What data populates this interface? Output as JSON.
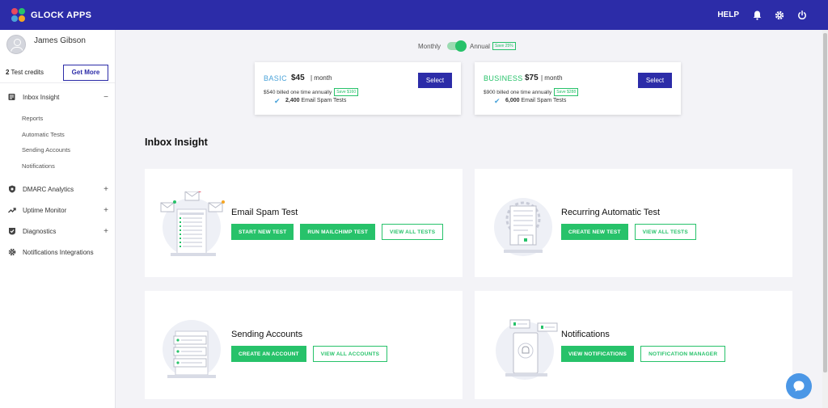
{
  "app": {
    "name": "GLOCK APPS"
  },
  "topbar": {
    "help": "HELP"
  },
  "user": {
    "name": "James Gibson",
    "credits_count": "2",
    "credits_label": "Test credits",
    "get_more": "Get More"
  },
  "sidebar": {
    "inbox": {
      "label": "Inbox Insight",
      "toggle": "−"
    },
    "subitems": [
      "Reports",
      "Automatic Tests",
      "Sending Accounts",
      "Notifications"
    ],
    "dmarc": {
      "label": "DMARC Analytics",
      "toggle": "+"
    },
    "uptime": {
      "label": "Uptime Monitor",
      "toggle": "+"
    },
    "diagnostics": {
      "label": "Diagnostics",
      "toggle": "+"
    },
    "notif_int": {
      "label": "Notifications Integrations"
    }
  },
  "billing": {
    "monthly": "Monthly",
    "annual": "Annual",
    "annual_save": "Save 25%"
  },
  "plans": [
    {
      "name": "BASIC",
      "price": "$45",
      "per": "| month",
      "billed": "$540 billed one time annually",
      "save": "Save $160",
      "tests_count": "2,400",
      "tests_label": "Email Spam Tests",
      "select": "Select",
      "color": "#4aa3d9"
    },
    {
      "name": "BUSINESS",
      "price": "$75",
      "per": "| month",
      "billed": "$900 billed one time annually",
      "save": "Save $288",
      "tests_count": "6,000",
      "tests_label": "Email Spam Tests",
      "select": "Select",
      "color": "#27c26a"
    }
  ],
  "section_title": "Inbox Insight",
  "cards": [
    {
      "title": "Email Spam Test",
      "buttons": [
        "START NEW TEST",
        "RUN MAILCHIMP TEST",
        "VIEW ALL TESTS"
      ]
    },
    {
      "title": "Recurring Automatic Test",
      "buttons": [
        "CREATE NEW TEST",
        "VIEW ALL TESTS"
      ]
    },
    {
      "title": "Sending Accounts",
      "buttons": [
        "CREATE AN ACCOUNT",
        "VIEW ALL ACCOUNTS"
      ]
    },
    {
      "title": "Notifications",
      "buttons": [
        "VIEW NOTIFICATIONS",
        "NOTIFICATION MANAGER"
      ]
    }
  ],
  "colors": {
    "brand": "#2c2ca8",
    "accent_green": "#27c26a",
    "accent_blue": "#4aa3d9",
    "chat": "#4b97e6"
  }
}
